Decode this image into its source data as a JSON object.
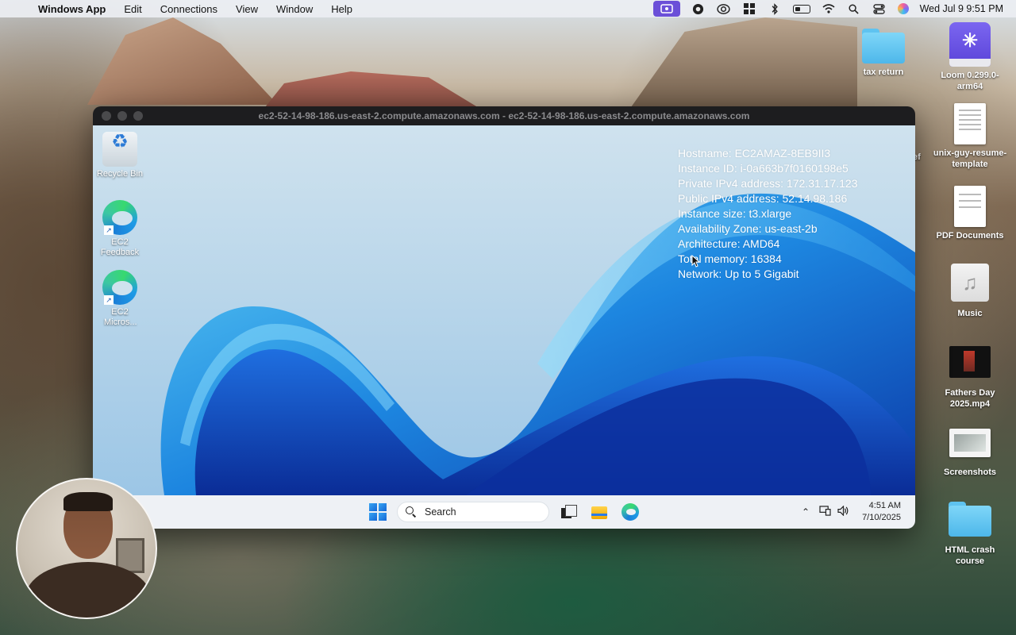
{
  "menubar": {
    "app_name": "Windows App",
    "menus": [
      "Edit",
      "Connections",
      "View",
      "Window",
      "Help"
    ],
    "datetime": "Wed Jul 9  9:51 PM"
  },
  "desktop_icons": [
    {
      "label": "tax return",
      "type": "folder"
    },
    {
      "label": "Loom 0.299.0-arm64",
      "type": "drive"
    },
    {
      "label": "unix-guy-resume-template",
      "type": "document"
    },
    {
      "label": "PDF Documents",
      "type": "document"
    },
    {
      "label": "Music",
      "type": "music"
    },
    {
      "label": "Fathers Day 2025.mp4",
      "type": "video"
    },
    {
      "label": "Screenshots",
      "type": "screenshot"
    },
    {
      "label": "HTML crash course",
      "type": "folder"
    }
  ],
  "partial_label": "ef",
  "remote_window": {
    "title": "ec2-52-14-98-186.us-east-2.compute.amazonaws.com - ec2-52-14-98-186.us-east-2.compute.amazonaws.com",
    "icons": [
      {
        "label": "Recycle Bin"
      },
      {
        "label": "EC2 Feedback"
      },
      {
        "label": "EC2 Micros..."
      }
    ],
    "bginfo": [
      "Hostname: EC2AMAZ-8EB9II3",
      "Instance ID: i-0a663b7f0160198e5",
      "Private IPv4 address: 172.31.17.123",
      "Public IPv4 address: 52.14.98.186",
      "Instance size: t3.xlarge",
      "Availability Zone: us-east-2b",
      "Architecture: AMD64",
      "Total memory: 16384",
      "Network: Up to 5 Gigabit"
    ],
    "taskbar": {
      "search_placeholder": "Search",
      "time": "4:51 AM",
      "date": "7/10/2025"
    }
  },
  "colors": {
    "loom_accent": "#6b4fd8",
    "wallpaper_blue": "#1466d6"
  }
}
